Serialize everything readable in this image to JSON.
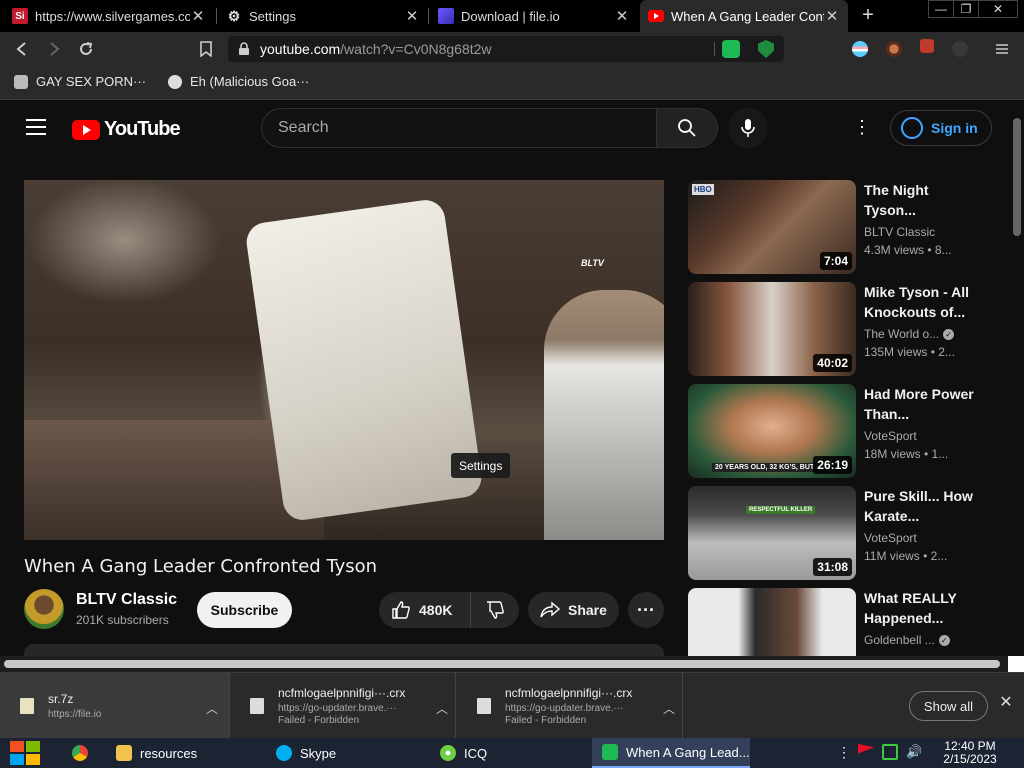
{
  "browser": {
    "tabs": [
      {
        "title": "https://www.silvergames.co",
        "favicon": "silvergames-icon",
        "active": false
      },
      {
        "title": "Settings",
        "favicon": "gear-icon",
        "active": false
      },
      {
        "title": "Download  |  file.io",
        "favicon": "fileio-icon",
        "active": false
      },
      {
        "title": "When A Gang Leader Confr",
        "favicon": "youtube-icon",
        "active": true
      }
    ],
    "window_controls": {
      "minimize": "—",
      "restore": "❐",
      "close": "✕"
    },
    "url": {
      "host": "youtube.com",
      "path": "/watch?v=Cv0N8g68t2w"
    },
    "extension_badge": "67",
    "bookmarks": [
      {
        "label": "GAY SEX PORN···"
      },
      {
        "label": "Eh (Malicious Goa···"
      }
    ]
  },
  "youtube": {
    "logo_text": "YouTube",
    "search_placeholder": "Search",
    "sign_in": "Sign in",
    "player": {
      "watermark": "BLTV",
      "tooltip": "Settings"
    },
    "video": {
      "title": "When A Gang Leader Confronted Tyson",
      "channel": "BLTV Classic",
      "subscribers": "201K subscribers",
      "subscribe_label": "Subscribe",
      "likes": "480K",
      "share_label": "Share"
    },
    "recommendations": [
      {
        "title": "The Night Tyson...",
        "channel": "BLTV Classic",
        "verified": false,
        "meta": "4.3M views  • 8...",
        "duration": "7:04"
      },
      {
        "title": "Mike Tyson - All Knockouts of...",
        "channel": "The World o...",
        "verified": true,
        "meta": "135M views  • 2...",
        "duration": "40:02"
      },
      {
        "title": "Had More Power Than...",
        "channel": "VoteSport",
        "verified": false,
        "meta": "18M views  • 1...",
        "duration": "26:19"
      },
      {
        "title": "Pure Skill... How Karate...",
        "channel": "VoteSport",
        "verified": false,
        "meta": "11M views  • 2...",
        "duration": "31:08"
      },
      {
        "title": "What REALLY Happened...",
        "channel": "Goldenbell ...",
        "verified": true,
        "meta": "",
        "duration": ""
      }
    ]
  },
  "downloads": {
    "items": [
      {
        "name": "sr.7z",
        "sub": "https://file.io"
      },
      {
        "name": "ncfmlogaelpnnifigi···.crx",
        "sub": "https://go-updater.brave.···",
        "status": "Failed - Forbidden"
      },
      {
        "name": "ncfmlogaelpnnifigi···.crx",
        "sub": "https://go-updater.brave.···",
        "status": "Failed - Forbidden"
      }
    ],
    "show_all": "Show all"
  },
  "taskbar": {
    "items": [
      {
        "label": "",
        "icon": "chrome-icon"
      },
      {
        "label": "resources",
        "icon": "folder-icon"
      },
      {
        "label": "Skype",
        "icon": "skype-icon"
      },
      {
        "label": "ICQ",
        "icon": "icq-icon"
      },
      {
        "label": "When A Gang Lead...",
        "icon": "browser-icon"
      }
    ],
    "time": "12:40 PM",
    "date": "2/15/2023"
  },
  "colors": {
    "youtube_red": "#ff0000",
    "link_blue": "#3ea6ff",
    "page_bg": "#0f0f0f",
    "chrome_bg": "#2a2a2a"
  }
}
